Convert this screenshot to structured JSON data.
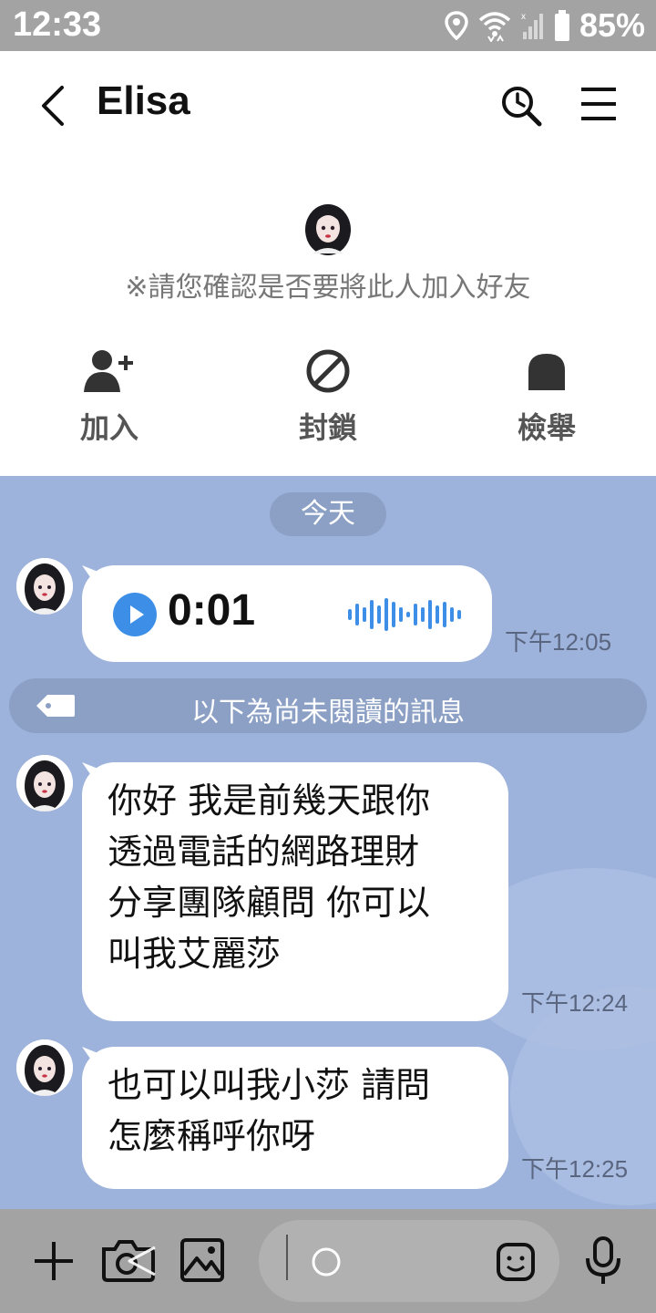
{
  "status_bar": {
    "time": "12:33",
    "battery": "85%",
    "icons": [
      "location-icon",
      "wifi-icon",
      "signal-icon",
      "battery-icon"
    ]
  },
  "header": {
    "title": "Elisa",
    "back_icon": "chevron-left-icon",
    "search_icon": "clock-search-icon",
    "menu_icon": "hamburger-menu-icon"
  },
  "friend_prompt": {
    "notice": "※請您確認是否要將此人加入好友",
    "actions": [
      {
        "label": "加入",
        "icon": "add-user-icon"
      },
      {
        "label": "封鎖",
        "icon": "block-icon"
      },
      {
        "label": "檢舉",
        "icon": "report-icon"
      }
    ]
  },
  "chat": {
    "date_label": "今天",
    "unread_divider": "以下為尚未閱讀的訊息",
    "messages": [
      {
        "type": "voice",
        "duration": "0:01",
        "time": "下午12:05"
      },
      {
        "type": "text",
        "text": "你好 我是前幾天跟你\n透過電話的網路理財\n分享團隊顧問 你可以\n叫我艾麗莎",
        "time": "下午12:24"
      },
      {
        "type": "text",
        "text": "也可以叫我小莎 請問\n怎麼稱呼你呀",
        "time": "下午12:25"
      }
    ]
  },
  "input_bar": {
    "icons": [
      "plus-icon",
      "camera-icon",
      "image-icon",
      "emoji-icon",
      "microphone-icon"
    ]
  },
  "colors": {
    "chat_background": "#9db3dc",
    "status_bar": "#a3a3a3",
    "play_button": "#3d8ee6",
    "waveform": "#3d8ee6"
  }
}
